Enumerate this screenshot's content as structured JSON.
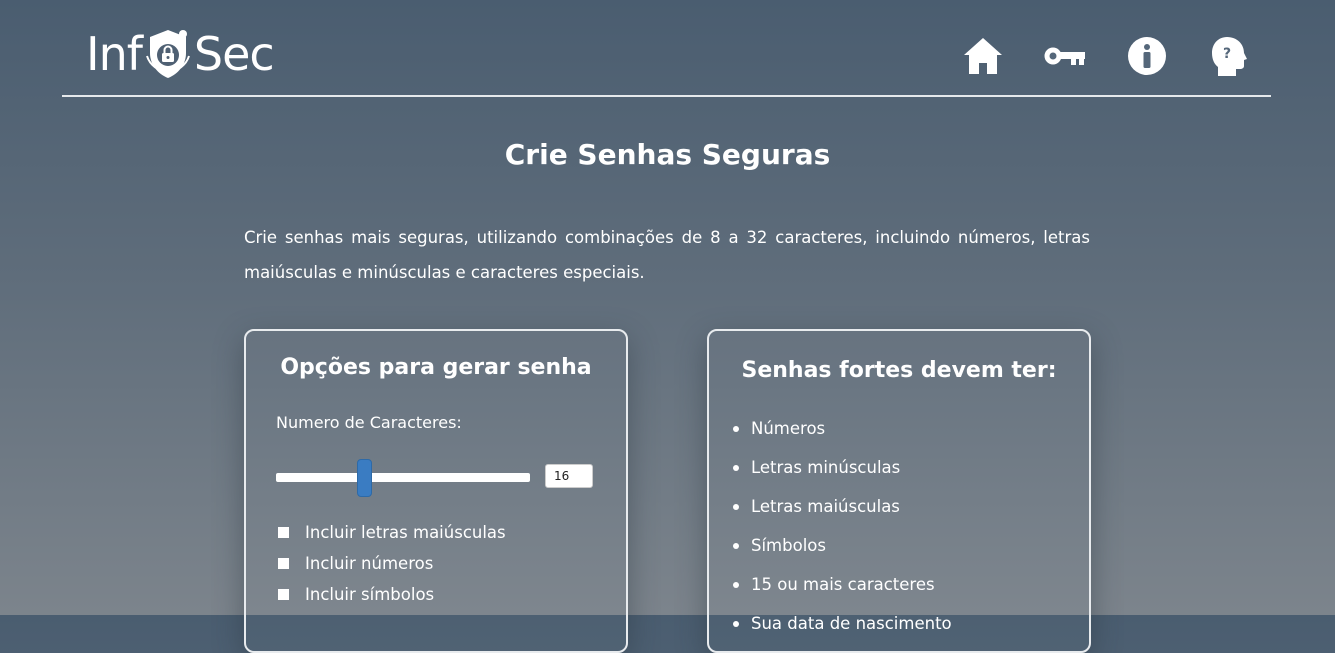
{
  "header": {
    "logo_left": "Inf",
    "logo_right": "Sec",
    "nav": [
      {
        "icon": "home-icon"
      },
      {
        "icon": "key-icon"
      },
      {
        "icon": "info-icon"
      },
      {
        "icon": "help-head-icon"
      }
    ]
  },
  "main": {
    "title": "Crie Senhas Seguras",
    "intro": "Crie senhas mais seguras, utilizando combinações de 8 a 32 caracteres, incluindo números, letras maiúsculas e minúsculas e caracteres especiais."
  },
  "options_card": {
    "title": "Opções para gerar senha",
    "length_label": "Numero de Caracteres:",
    "length_value": "16",
    "slider_min": 8,
    "slider_max": 32,
    "slider_value": 16,
    "options": [
      {
        "label": "Incluir letras maiúsculas"
      },
      {
        "label": "Incluir números"
      },
      {
        "label": "Incluir símbolos"
      }
    ]
  },
  "tips_card": {
    "title": "Senhas fortes devem ter:",
    "items": [
      {
        "label": "Números"
      },
      {
        "label": "Letras minúsculas"
      },
      {
        "label": "Letras maiúsculas"
      },
      {
        "label": "Símbolos"
      },
      {
        "label": "15 ou mais caracteres"
      },
      {
        "label": "Sua data de nascimento"
      }
    ]
  },
  "colors": {
    "accent": "#3a7cc2",
    "background_top": "#4a5d70",
    "background_bottom": "#7c848c"
  }
}
